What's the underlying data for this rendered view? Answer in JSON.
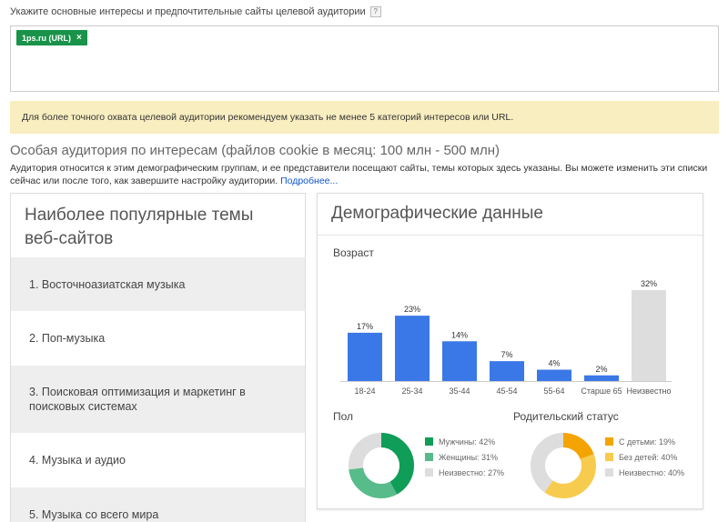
{
  "top_label": "Укажите основные интересы и предпочтительные сайты целевой аудитории",
  "help_icon": "?",
  "url_chips": [
    {
      "label": "1ps.ru (URL)",
      "remove_glyph": "×"
    }
  ],
  "notice": "Для более точного охвата целевой аудитории рекомендуем указать не менее 5 категорий интересов или URL.",
  "audience": {
    "title": "Особая аудитория по интересам (файлов cookie в месяц: 100 млн - 500 млн)",
    "description": "Аудитория относится к этим демографическим группам, и ее представители посещают сайты, темы которых здесь указаны. Вы можете изменить эти списки сейчас или после того, как завершите настройку аудитории.",
    "more_link": "Подробнее..."
  },
  "topics_panel": {
    "title": "Наиболее популярные темы веб-сайтов",
    "items": [
      "1. Восточноазиатская музыка",
      "2. Поп-музыка",
      "3. Поисковая оптимизация и маркетинг в поисковых системах",
      "4. Музыка и аудио",
      "5. Музыка со всего мира"
    ]
  },
  "demographics": {
    "title": "Демографические данные",
    "age_label": "Возраст",
    "gender_label": "Пол",
    "parental_label": "Родительский статус"
  },
  "colors": {
    "bar_blue": "#3b78e7",
    "bar_gray": "#dddddd",
    "male": "#0f9d58",
    "female": "#57bb8a",
    "unknown": "#dddddd",
    "with_kids": "#f4a400",
    "no_kids": "#f7cb4d",
    "chip_green": "#19934a",
    "notice_bg": "#f8eec0"
  },
  "chart_data": [
    {
      "type": "bar",
      "title": "Возраст",
      "categories": [
        "18-24",
        "25-34",
        "35-44",
        "45-54",
        "55-64",
        "Старше 65",
        "Неизвестно"
      ],
      "values": [
        17,
        23,
        14,
        7,
        4,
        2,
        32
      ],
      "labels": [
        "17%",
        "23%",
        "14%",
        "7%",
        "4%",
        "2%",
        "32%"
      ],
      "ylim": [
        0,
        32
      ]
    },
    {
      "type": "pie",
      "title": "Пол",
      "categories": [
        "Мужчины",
        "Женщины",
        "Неизвестно"
      ],
      "values": [
        42,
        31,
        27
      ],
      "legend": [
        "Мужчины: 42%",
        "Женщины: 31%",
        "Неизвестно: 27%"
      ]
    },
    {
      "type": "pie",
      "title": "Родительский статус",
      "categories": [
        "С детьми",
        "Без детей",
        "Неизвестно"
      ],
      "values": [
        19,
        40,
        40
      ],
      "legend": [
        "С детьми: 19%",
        "Без детей: 40%",
        "Неизвестно: 40%"
      ]
    }
  ]
}
